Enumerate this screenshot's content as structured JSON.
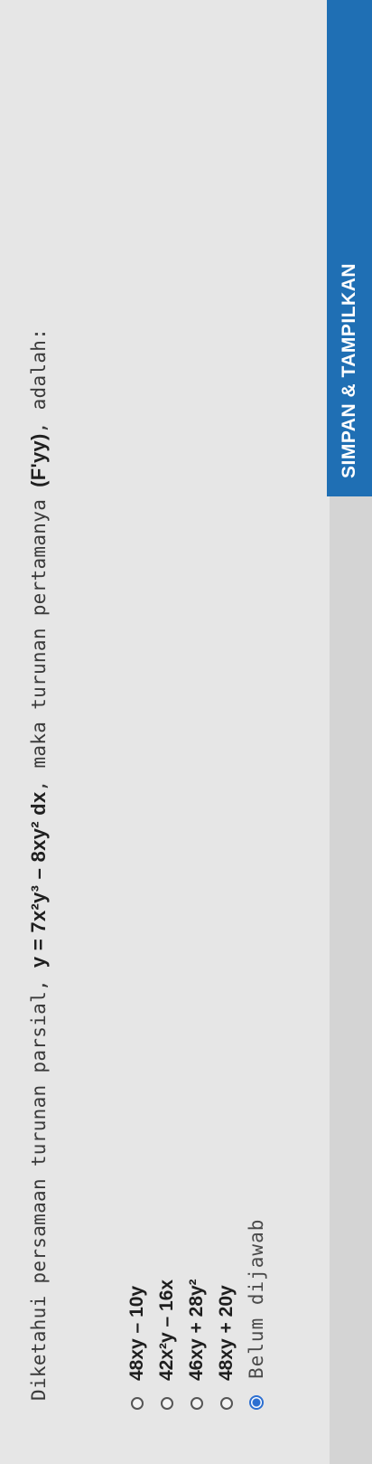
{
  "question": {
    "text_before": "Diketahui persamaan turunan parsial, ",
    "equation": "y = 7x²y³ – 8xy² dx",
    "text_middle": ", maka turunan pertamanya ",
    "term": "(F'yy)",
    "text_after": ", adalah:"
  },
  "options": [
    {
      "label": "48xy – 10y",
      "selected": false
    },
    {
      "label": "42x²y – 16x",
      "selected": false
    },
    {
      "label": "46xy + 28y²",
      "selected": false
    },
    {
      "label": "48xy + 20y",
      "selected": false
    }
  ],
  "status": {
    "label": "Belum dijawab",
    "selected": true
  },
  "submit": {
    "label": "SIMPAN & TAMPILKAN"
  },
  "colors": {
    "accent": "#1f6fb4",
    "radio_selected": "#2c6fd1"
  }
}
